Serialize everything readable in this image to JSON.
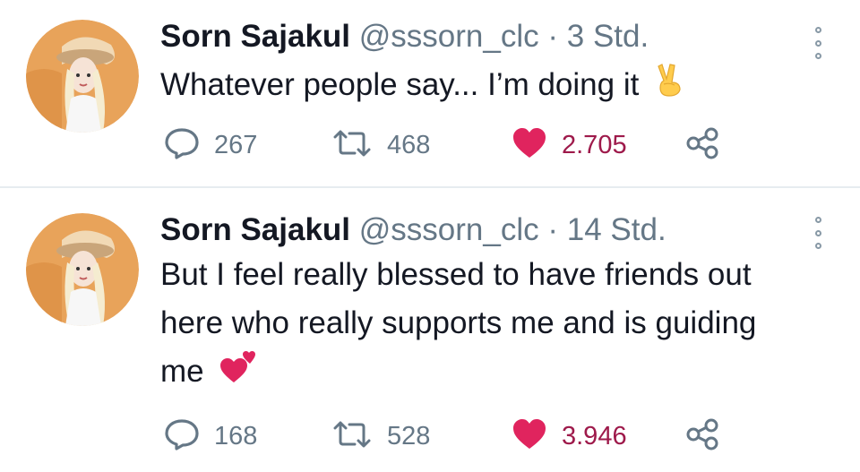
{
  "tweets": [
    {
      "author": {
        "name": "Sorn Sajakul",
        "handle": "@sssorn_clc",
        "separator": "·",
        "time": "3 Std."
      },
      "text": "Whatever people say... I’m doing it",
      "emoji_icon": "victory-hand-icon",
      "stats": {
        "replies": "267",
        "retweets": "468",
        "likes": "2.705"
      }
    },
    {
      "author": {
        "name": "Sorn Sajakul",
        "handle": "@sssorn_clc",
        "separator": "·",
        "time": "14 Std."
      },
      "text": "But I feel really blessed to have friends out here who really supports me and is guiding me",
      "emoji_icon": "two-hearts-icon",
      "stats": {
        "replies": "168",
        "retweets": "528",
        "likes": "3.946"
      }
    }
  ],
  "colors": {
    "text": "#141823",
    "secondary": "#657786",
    "like": "#e0245e",
    "like_count": "#9e1a4b",
    "divider": "#e6ecf0"
  }
}
